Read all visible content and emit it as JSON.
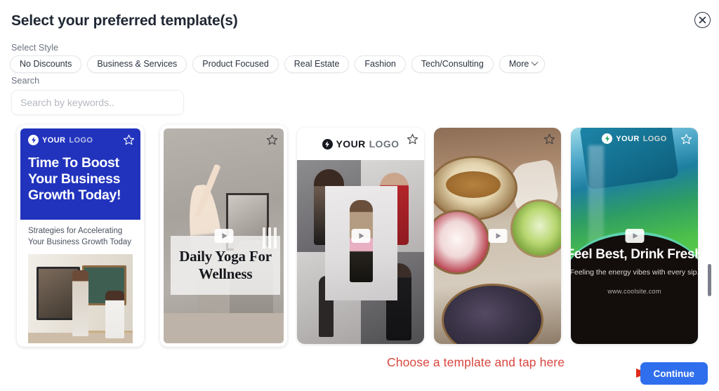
{
  "header": {
    "title": "Select your preferred template(s)",
    "close_icon": "close-circle-icon"
  },
  "filters": {
    "style_label": "Select Style",
    "chips": [
      {
        "label": "No Discounts"
      },
      {
        "label": "Business & Services"
      },
      {
        "label": "Product Focused"
      },
      {
        "label": "Real Estate"
      },
      {
        "label": "Fashion"
      },
      {
        "label": "Tech/Consulting"
      }
    ],
    "more_label": "More",
    "more_icon": "chevron-down-icon"
  },
  "search": {
    "label": "Search",
    "placeholder": "Search by keywords..",
    "value": "",
    "icon": "search-icon"
  },
  "gallery": {
    "favorite_icon": "star-outline-icon",
    "play_icon": "play-icon",
    "templates": [
      {
        "id": "business-growth",
        "logo_brand": "YOUR",
        "logo_word": "LOGO",
        "logo_icon": "flash-badge-icon",
        "headline": "Time To Boost Your Business Growth Today!",
        "subheadline": "Strategies for Accelerating Your Business Growth Today",
        "accent_color": "#2133bd",
        "has_video": false
      },
      {
        "id": "daily-yoga",
        "headline": "Daily Yoga For Wellness",
        "has_video": true
      },
      {
        "id": "fashion-lookbook",
        "logo_brand": "YOUR",
        "logo_word": "LOGO",
        "logo_icon": "flash-badge-icon",
        "has_video": true
      },
      {
        "id": "healthy-bowls",
        "has_video": true
      },
      {
        "id": "feel-best-drink-fresh",
        "logo_brand": "YOUR",
        "logo_word": "LOGO",
        "logo_icon": "flash-badge-icon",
        "headline": "Feel Best, Drink Fresh",
        "subheadline": "Feeling the energy vibes with every sip.",
        "url": "www.coolsite.com",
        "has_video": true
      }
    ]
  },
  "footer": {
    "annotation": "Choose a template and tap here",
    "annotation_color": "#d9473f",
    "arrow_icon": "arrow-right-icon",
    "continue_label": "Continue",
    "continue_color": "#2f6fed"
  },
  "scrollbar": {
    "name": "vertical-scrollbar"
  }
}
